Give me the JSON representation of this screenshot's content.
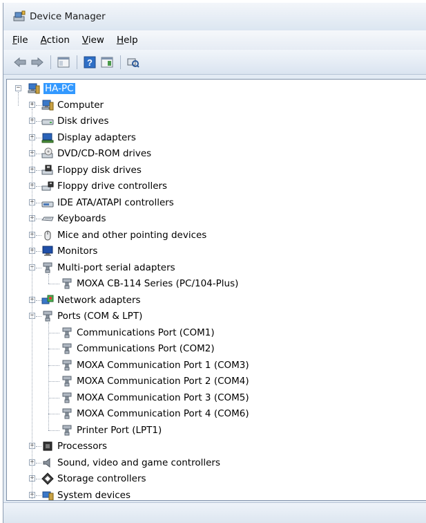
{
  "window": {
    "title": "Device Manager"
  },
  "menu": [
    {
      "key": "F",
      "rest": "ile"
    },
    {
      "key": "A",
      "rest": "ction"
    },
    {
      "key": "V",
      "rest": "iew"
    },
    {
      "key": "H",
      "rest": "elp"
    }
  ],
  "toolbar": {
    "buttons": [
      "back-icon",
      "forward-icon",
      "properties-icon",
      "help-icon",
      "view-icon",
      "scan-hardware-icon"
    ]
  },
  "tree": {
    "root": {
      "label": "HA-PC",
      "icon": "computer-icon"
    },
    "items": [
      {
        "label": "Computer",
        "icon": "computer-icon",
        "expanded": false,
        "children": []
      },
      {
        "label": "Disk drives",
        "icon": "disk-icon",
        "expanded": false,
        "children": []
      },
      {
        "label": "Display adapters",
        "icon": "display-icon",
        "expanded": false,
        "children": []
      },
      {
        "label": "DVD/CD-ROM drives",
        "icon": "dvd-icon",
        "expanded": false,
        "children": []
      },
      {
        "label": "Floppy disk drives",
        "icon": "floppy-icon",
        "expanded": false,
        "children": []
      },
      {
        "label": "Floppy drive controllers",
        "icon": "floppy-controller-icon",
        "expanded": false,
        "children": []
      },
      {
        "label": "IDE ATA/ATAPI controllers",
        "icon": "ide-icon",
        "expanded": false,
        "children": []
      },
      {
        "label": "Keyboards",
        "icon": "keyboard-icon",
        "expanded": false,
        "children": []
      },
      {
        "label": "Mice and other pointing devices",
        "icon": "mouse-icon",
        "expanded": false,
        "children": []
      },
      {
        "label": "Monitors",
        "icon": "monitor-icon",
        "expanded": false,
        "children": []
      },
      {
        "label": "Multi-port serial adapters",
        "icon": "port-icon",
        "expanded": true,
        "children": [
          "MOXA CB-114 Series (PC/104-Plus)"
        ]
      },
      {
        "label": "Network adapters",
        "icon": "network-icon",
        "expanded": false,
        "children": []
      },
      {
        "label": "Ports (COM & LPT)",
        "icon": "port-icon",
        "expanded": true,
        "children": [
          "Communications Port (COM1)",
          "Communications Port (COM2)",
          "MOXA Communication Port 1 (COM3)",
          "MOXA Communication Port 2 (COM4)",
          "MOXA Communication Port 3 (COM5)",
          "MOXA Communication Port 4 (COM6)",
          "Printer Port (LPT1)"
        ]
      },
      {
        "label": "Processors",
        "icon": "processor-icon",
        "expanded": false,
        "children": []
      },
      {
        "label": "Sound, video and game controllers",
        "icon": "sound-icon",
        "expanded": false,
        "children": []
      },
      {
        "label": "Storage controllers",
        "icon": "storage-icon",
        "expanded": false,
        "children": []
      },
      {
        "label": "System devices",
        "icon": "system-icon",
        "expanded": false,
        "children": []
      }
    ]
  },
  "colors": {
    "selection": "#3399ff",
    "chrome": "#e3ebf4"
  }
}
